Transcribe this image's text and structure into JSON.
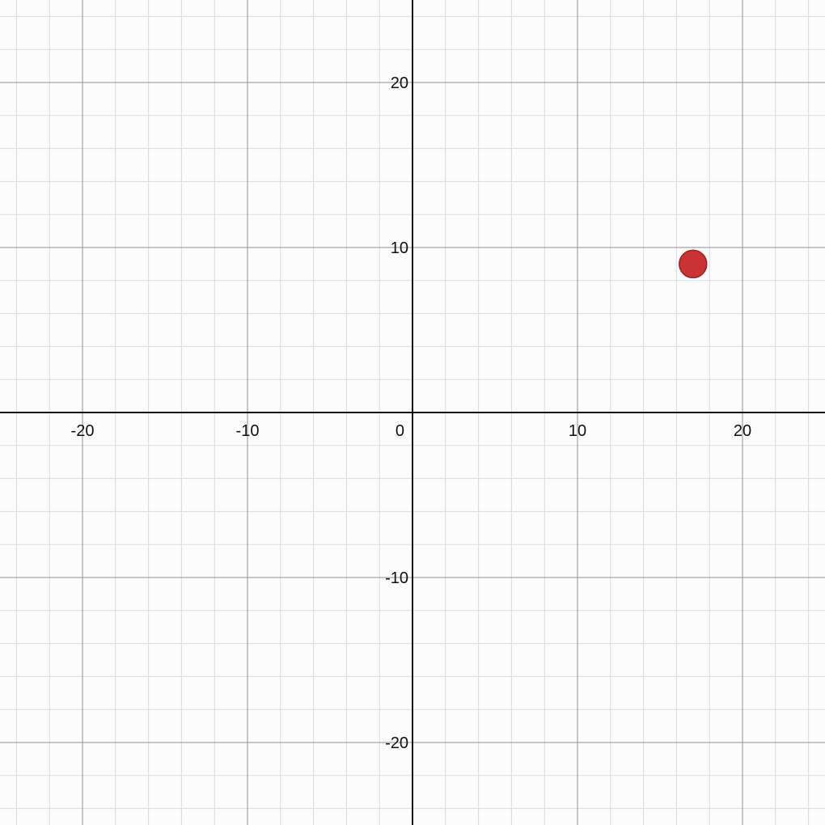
{
  "chart_data": {
    "type": "scatter",
    "title": "",
    "xlabel": "",
    "ylabel": "",
    "xlim": [
      -25,
      25
    ],
    "ylim": [
      -25,
      25
    ],
    "grid": true,
    "major_step": 10,
    "minor_step": 2,
    "x_ticks": [
      {
        "value": -20,
        "label": "-20"
      },
      {
        "value": -10,
        "label": "-10"
      },
      {
        "value": 10,
        "label": "10"
      },
      {
        "value": 20,
        "label": "20"
      }
    ],
    "y_ticks": [
      {
        "value": 20,
        "label": "20"
      },
      {
        "value": 10,
        "label": "10"
      },
      {
        "value": -10,
        "label": "-10"
      },
      {
        "value": -20,
        "label": "-20"
      }
    ],
    "origin_label": "0",
    "series": [
      {
        "points": [
          {
            "x": 17,
            "y": 9
          }
        ],
        "color": "#c62828"
      }
    ]
  }
}
